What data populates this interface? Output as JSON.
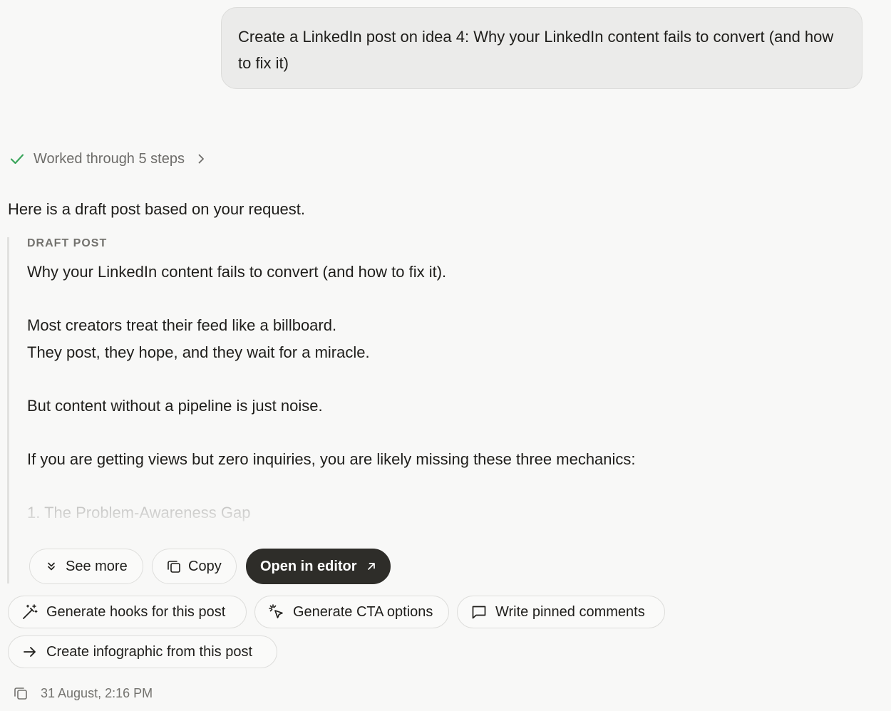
{
  "user_message": "Create a LinkedIn post on idea 4: Why your LinkedIn content fails to convert (and how to fix it)",
  "steps": {
    "label": "Worked through 5 steps"
  },
  "intro": "Here is a draft post based on your request.",
  "draft": {
    "label": "DRAFT POST",
    "lines": [
      "Why your LinkedIn content fails to convert (and how to fix it).",
      "",
      "Most creators treat their feed like a billboard.",
      "They post, they hope, and they wait for a miracle.",
      "",
      "But content without a pipeline is just noise.",
      "",
      "If you are getting views but zero inquiries, you are likely missing these three mechanics:",
      "",
      "1. The Problem-Awareness Gap"
    ]
  },
  "actions": {
    "see_more": "See more",
    "copy": "Copy",
    "open_editor": "Open in editor"
  },
  "suggestions": {
    "hooks": "Generate hooks for this post",
    "cta": "Generate CTA options",
    "pinned": "Write pinned comments",
    "infographic": "Create infographic from this post"
  },
  "footer": {
    "timestamp": "31 August, 2:16 PM"
  },
  "icons": {
    "steps_status": "check-icon",
    "steps_expand": "chevron-right-icon",
    "see_more": "chevrons-down-icon",
    "copy": "copy-icon",
    "open_editor": "arrow-up-right-icon",
    "hooks": "magic-wand-icon",
    "cta": "cursor-click-icon",
    "pinned": "message-square-icon",
    "infographic": "arrow-right-icon",
    "footer_copy": "copy-icon"
  },
  "colors": {
    "background": "#f8f8f7",
    "check": "#3aa55b",
    "dark_button": "#2e2d29",
    "muted_text": "#73726e"
  }
}
